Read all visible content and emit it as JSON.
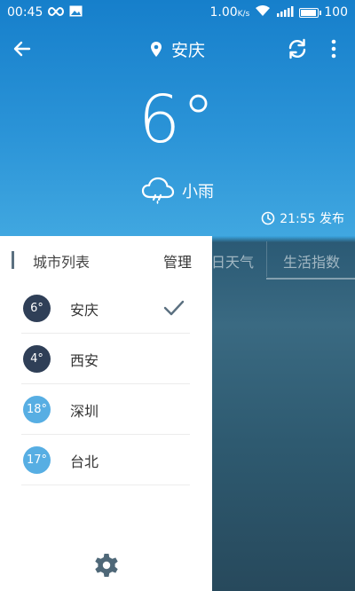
{
  "status_bar": {
    "time": "00:45",
    "net_speed": "1.00",
    "net_speed_unit": "K/s",
    "battery": "100"
  },
  "header": {
    "location": "安庆",
    "temperature": "6°",
    "condition": "小雨",
    "publish_time": "21:55 发布"
  },
  "tabs": [
    {
      "label": "日天气"
    },
    {
      "label": "生活指数"
    }
  ],
  "drawer": {
    "title": "城市列表",
    "manage_label": "管理",
    "cities": [
      {
        "temp": "6°",
        "name": "安庆",
        "badge_color": "#2f3f57",
        "selected": true
      },
      {
        "temp": "4°",
        "name": "西安",
        "badge_color": "#2f3f57",
        "selected": false
      },
      {
        "temp": "18°",
        "name": "深圳",
        "badge_color": "#57aee3",
        "selected": false
      },
      {
        "temp": "17°",
        "name": "台北",
        "badge_color": "#57aee3",
        "selected": false
      }
    ]
  },
  "colors": {
    "header_blue": "#1e86cf",
    "badge_dark": "#2f3f57",
    "badge_light": "#57aee3",
    "accent_bar": "#5b7080"
  }
}
